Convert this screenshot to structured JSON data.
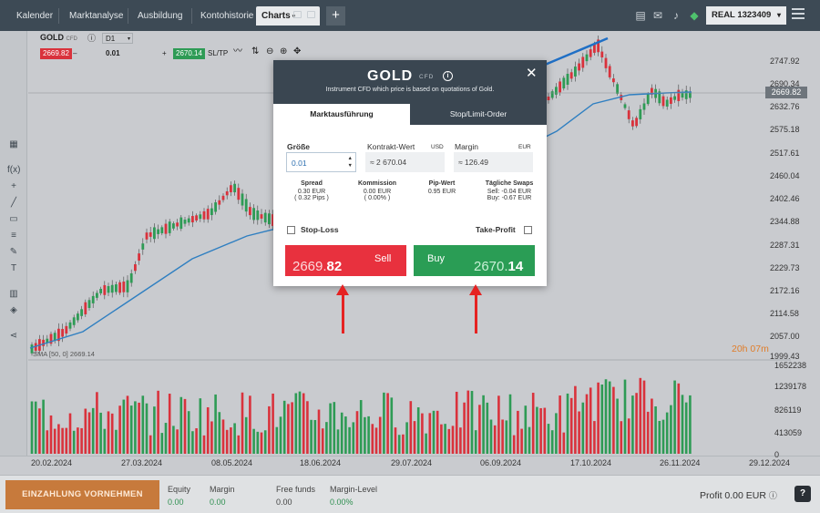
{
  "nav": {
    "tabs": [
      "Kalender",
      "Marktanalyse",
      "Ausbildung",
      "Kontohistorie",
      "Charts"
    ],
    "account": "REAL  1323409"
  },
  "chart": {
    "symbol": "GOLD",
    "symbol_tag": "CFD",
    "timeframe": "D1",
    "sell_price": "2669.82",
    "buy_price": "2670.14",
    "lot": "0.01",
    "sltp": "SL/TP",
    "current_price": "2669.82",
    "timer": "20h 07m",
    "sma_label": "SMA [50, 0] 2669.14",
    "y_labels": [
      "2747.92",
      "2690.34",
      "2632.76",
      "2575.18",
      "2517.61",
      "2460.04",
      "2402.46",
      "2344.88",
      "2287.31",
      "2229.73",
      "2172.16",
      "2114.58",
      "2057.00",
      "1999.43"
    ],
    "volume_labels": [
      "1652238",
      "1239178",
      "826119",
      "413059",
      "0"
    ],
    "x_labels": [
      "20.02.2024",
      "27.03.2024",
      "08.05.2024",
      "18.06.2024",
      "29.07.2024",
      "06.09.2024",
      "17.10.2024",
      "26.11.2024",
      "29.12.2024"
    ],
    "colors": {
      "up": "#2e9b55",
      "down": "#d9323c",
      "sma": "#2f7fc1"
    }
  },
  "modal": {
    "title": "GOLD",
    "title_tag": "CFD",
    "subtitle": "Instrument CFD which price is based on quotations of Gold.",
    "tab_market": "Marktausführung",
    "tab_stop": "Stop/Limit-Order",
    "size_label": "Größe",
    "size_value": "0.01",
    "contract_label": "Kontrakt-Wert",
    "contract_unit": "USD",
    "contract_value": "≈ 2 670.04",
    "margin_label": "Margin",
    "margin_unit": "EUR",
    "margin_value": "≈ 126.49",
    "spread_label": "Spread",
    "spread_value": "0.30 EUR",
    "spread_pips": "( 0.32 Pips )",
    "commission_label": "Kommission",
    "commission_value": "0.00 EUR",
    "commission_pct": "( 0.00% )",
    "pip_label": "Pip-Wert",
    "pip_value": "0.95 EUR",
    "swaps_label": "Tägliche Swaps",
    "swap_sell": "Sell: -0.04 EUR",
    "swap_buy": "Buy: -0.67 EUR",
    "stop_loss": "Stop-Loss",
    "take_profit": "Take-Profit",
    "sell_label": "Sell",
    "sell_price_main": "2669.",
    "sell_price_big": "82",
    "buy_label": "Buy",
    "buy_price_main": "2670.",
    "buy_price_big": "14"
  },
  "bottom": {
    "deposit": "EINZAHLUNG VORNEHMEN",
    "equity_label": "Equity",
    "equity_value": "0.00",
    "margin_label": "Margin",
    "margin_value": "0.00",
    "free_label": "Free funds",
    "free_value": "0.00",
    "level_label": "Margin-Level",
    "level_value": "0.00%",
    "profit": "Profit 0.00 EUR",
    "help": "?"
  }
}
